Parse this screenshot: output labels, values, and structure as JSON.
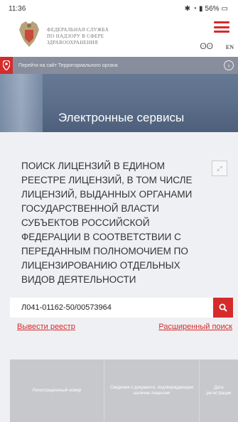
{
  "status_bar": {
    "time": "11:36",
    "battery": "56%"
  },
  "header": {
    "org_lines": [
      "ФЕДЕРАЛЬНАЯ СЛУЖБА",
      "ПО НАДЗОРУ В СФЕРЕ",
      "ЗДРАВООХРАНЕНИЯ"
    ],
    "lang": "EN"
  },
  "banner": {
    "territory_text": "Перейти на сайт Территориального органа",
    "page_title": "Электронные сервисы"
  },
  "card": {
    "title": "ПОИСК ЛИЦЕНЗИЙ В ЕДИНОМ РЕЕСТРЕ ЛИЦЕНЗИЙ, В ТОМ ЧИСЛЕ ЛИЦЕНЗИЙ, ВЫДАННЫХ ОРГАНАМИ ГОСУДАРСТВЕННОЙ ВЛАСТИ СУБЪЕКТОВ РОССИЙСКОЙ ФЕДЕРАЦИИ В СООТВЕТСТВИИ С ПЕРЕДАННЫМ ПОЛНОМОЧИЕМ ПО ЛИЦЕНЗИРОВАНИЮ ОТДЕЛЬНЫХ ВИДОВ ДЕЯТЕЛЬНОСТИ"
  },
  "search": {
    "value": "Л041-01162-50/00573964"
  },
  "links": {
    "export": "Вывести реестр",
    "advanced": "Расширенный поиск"
  },
  "table": {
    "headers": [
      "Регистрационный номер",
      "Сведения о документе, подтверждающем наличие лицензии",
      "Дата регистрации"
    ]
  },
  "colors": {
    "accent": "#d52b2b",
    "banner": "#5c6f8b",
    "table_header": "#c6c8cc"
  }
}
